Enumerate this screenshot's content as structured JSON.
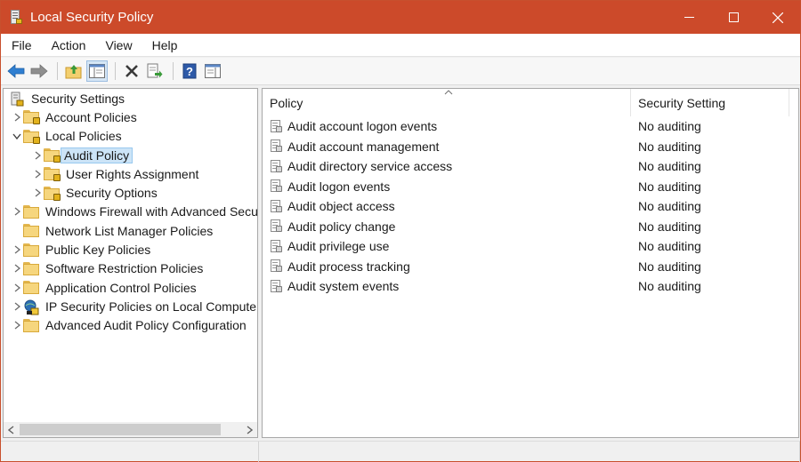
{
  "window": {
    "title": "Local Security Policy",
    "titlebar_color": "#cc4a2a",
    "controls": [
      "minimize-icon",
      "maximize-icon",
      "close-icon"
    ]
  },
  "menu": {
    "items": [
      "File",
      "Action",
      "View",
      "Help"
    ]
  },
  "toolbar": {
    "buttons": [
      "back-arrow-icon",
      "forward-arrow-icon",
      "up-folder-icon",
      "show-hide-tree-icon",
      "delete-icon",
      "export-list-icon",
      "help-icon",
      "properties-pane-icon"
    ]
  },
  "tree": {
    "items": [
      {
        "label": "Security Settings",
        "icon": "security-settings-icon",
        "expander": "none",
        "indent": 0
      },
      {
        "label": "Account Policies",
        "icon": "locked-folder-icon",
        "expander": "collapsed",
        "indent": 1
      },
      {
        "label": "Local Policies",
        "icon": "locked-folder-icon",
        "expander": "expanded",
        "indent": 1
      },
      {
        "label": "Audit Policy",
        "icon": "locked-folder-icon",
        "expander": "collapsed",
        "indent": 2,
        "selected": true
      },
      {
        "label": "User Rights Assignment",
        "icon": "locked-folder-icon",
        "expander": "collapsed",
        "indent": 2
      },
      {
        "label": "Security Options",
        "icon": "locked-folder-icon",
        "expander": "collapsed",
        "indent": 2
      },
      {
        "label": "Windows Firewall with Advanced Secu",
        "icon": "folder-icon",
        "expander": "collapsed",
        "indent": 1
      },
      {
        "label": "Network List Manager Policies",
        "icon": "folder-icon",
        "expander": "none",
        "indent": 1
      },
      {
        "label": "Public Key Policies",
        "icon": "folder-icon",
        "expander": "collapsed",
        "indent": 1
      },
      {
        "label": "Software Restriction Policies",
        "icon": "folder-icon",
        "expander": "collapsed",
        "indent": 1
      },
      {
        "label": "Application Control Policies",
        "icon": "folder-icon",
        "expander": "collapsed",
        "indent": 1
      },
      {
        "label": "IP Security Policies on Local Compute",
        "icon": "ip-security-icon",
        "expander": "collapsed",
        "indent": 1
      },
      {
        "label": "Advanced Audit Policy Configuration",
        "icon": "folder-icon",
        "expander": "collapsed",
        "indent": 1
      }
    ]
  },
  "list": {
    "columns": {
      "policy": "Policy",
      "setting": "Security Setting"
    },
    "sorted_by": "policy",
    "rows": [
      {
        "policy": "Audit account logon events",
        "setting": "No auditing"
      },
      {
        "policy": "Audit account management",
        "setting": "No auditing"
      },
      {
        "policy": "Audit directory service access",
        "setting": "No auditing"
      },
      {
        "policy": "Audit logon events",
        "setting": "No auditing"
      },
      {
        "policy": "Audit object access",
        "setting": "No auditing"
      },
      {
        "policy": "Audit policy change",
        "setting": "No auditing"
      },
      {
        "policy": "Audit privilege use",
        "setting": "No auditing"
      },
      {
        "policy": "Audit process tracking",
        "setting": "No auditing"
      },
      {
        "policy": "Audit system events",
        "setting": "No auditing"
      }
    ]
  }
}
